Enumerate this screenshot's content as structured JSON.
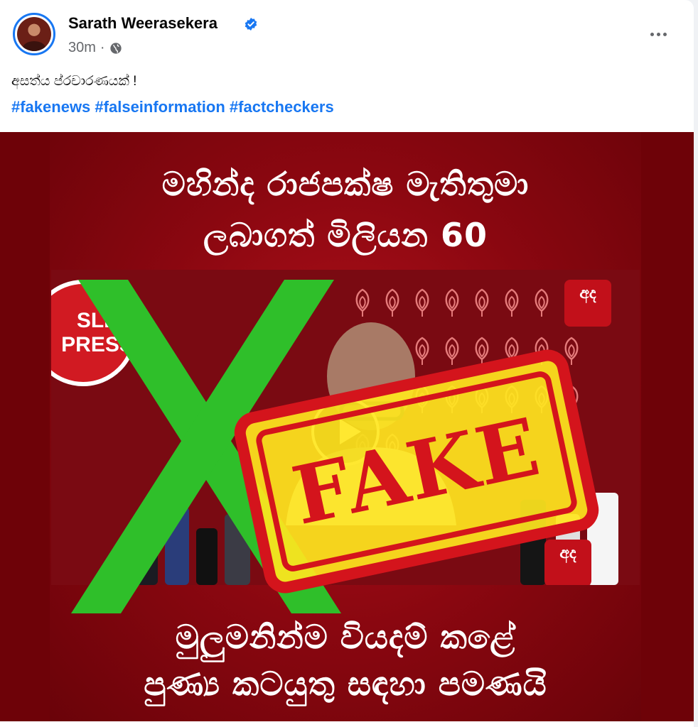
{
  "post": {
    "author": "Sarath Weerasekera",
    "time": "30m",
    "separator": "·",
    "text": "අසත්ය ප්රචාරණයක් !",
    "hashtags": [
      "#fakenews",
      "#falseinformation",
      "#factcheckers"
    ],
    "more_icon": "more-options-icon",
    "verified_icon": "verified-badge-icon",
    "privacy_icon": "globe-icon"
  },
  "media": {
    "headline_top_line1": "මහින්ද රාජපක්ෂ මැතිතුමා",
    "headline_top_line2": "ලබාගත් මිලියන 60",
    "headline_bottom_line1": "මුලුමනින්ම වියදම් කළේ",
    "headline_bottom_line2": "පුණ්‍ය කටයුතු සඳහා පමණයි",
    "stamp_text": "FAKE",
    "badge_line1": "SLP",
    "badge_line2": "PRESS",
    "channel_logo_text": "අද",
    "colors": {
      "background": "#8a0710",
      "cross": "#2fbf2a",
      "stamp_red": "#d4141c",
      "stamp_yellow": "#ffe61e"
    }
  }
}
